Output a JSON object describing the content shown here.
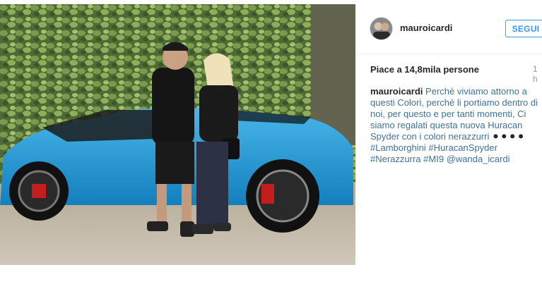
{
  "post": {
    "username": "mauroicardi",
    "follow_label": "SEGUI",
    "likes": "Piace a 14,8mila persone",
    "time": "1 h",
    "caption_user": "mauroicardi",
    "caption_text": "Perché viviamo attorno a questi Colori, perché li portiamo dentro di noi, per questo e per tanti momenti, Ci siamo regalati questa nuova Huracan Spyder con i colori nerazzurri",
    "caption_emoji": "⚫⚫⚫⚫",
    "hashtags": [
      "#Lamborghini",
      "#HuracanSpyder",
      "#Nerazzurra",
      "#MI9",
      "@wanda_icardi"
    ]
  },
  "colors": {
    "link": "#3f729b",
    "follow": "#3897f0",
    "car": "#1e9ad6"
  },
  "icons": {
    "photo": "post-photo-image",
    "avatar": "profile-avatar"
  }
}
